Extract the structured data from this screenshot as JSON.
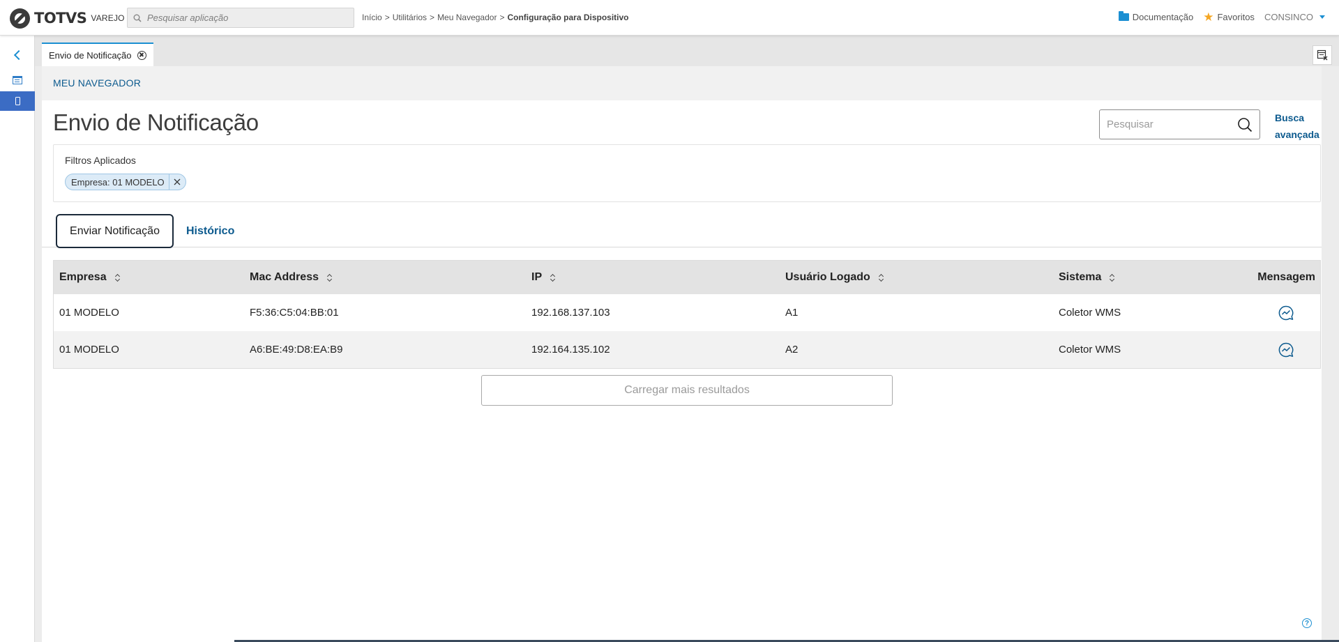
{
  "header": {
    "logo_text": "TOTVS",
    "logo_sub": "VAREJO",
    "search_placeholder": "Pesquisar aplicação",
    "breadcrumb": [
      "Início",
      "Utilitários",
      "Meu Navegador",
      "Configuração para Dispositivo"
    ],
    "breadcrumb_sep": ">",
    "documentation": "Documentação",
    "favorites": "Favoritos",
    "user": "CONSINCO"
  },
  "tabstrip": {
    "tab_label": "Envio de Notificação"
  },
  "page": {
    "section_label": "MEU NAVEGADOR",
    "title": "Envio de Notificação",
    "search_placeholder": "Pesquisar",
    "advanced_search": "Busca avançada"
  },
  "filters": {
    "label": "Filtros Aplicados",
    "chips": [
      "Empresa: 01 MODELO"
    ]
  },
  "tabs": {
    "send": "Enviar Notificação",
    "history": "Histórico"
  },
  "table": {
    "columns": [
      "Empresa",
      "Mac Address",
      "IP",
      "Usuário Logado",
      "Sistema",
      "Mensagem"
    ],
    "rows": [
      {
        "empresa": "01 MODELO",
        "mac": "F5:36:C5:04:BB:01",
        "ip": "192.168.137.103",
        "usuario": "A1",
        "sistema": "Coletor WMS"
      },
      {
        "empresa": "01 MODELO",
        "mac": "A6:BE:49:D8:EA:B9",
        "ip": "192.164.135.102",
        "usuario": "A2",
        "sistema": "Coletor WMS"
      }
    ]
  },
  "load_more": "Carregar mais resultados",
  "colors": {
    "accent": "#1b8fd2",
    "link": "#0c5a8e",
    "rail_active": "#3b6cc4"
  },
  "icons": {
    "search": "search-icon",
    "folder": "folder-icon",
    "star": "star-icon",
    "message": "chat-trend-icon",
    "help": "help-icon"
  }
}
